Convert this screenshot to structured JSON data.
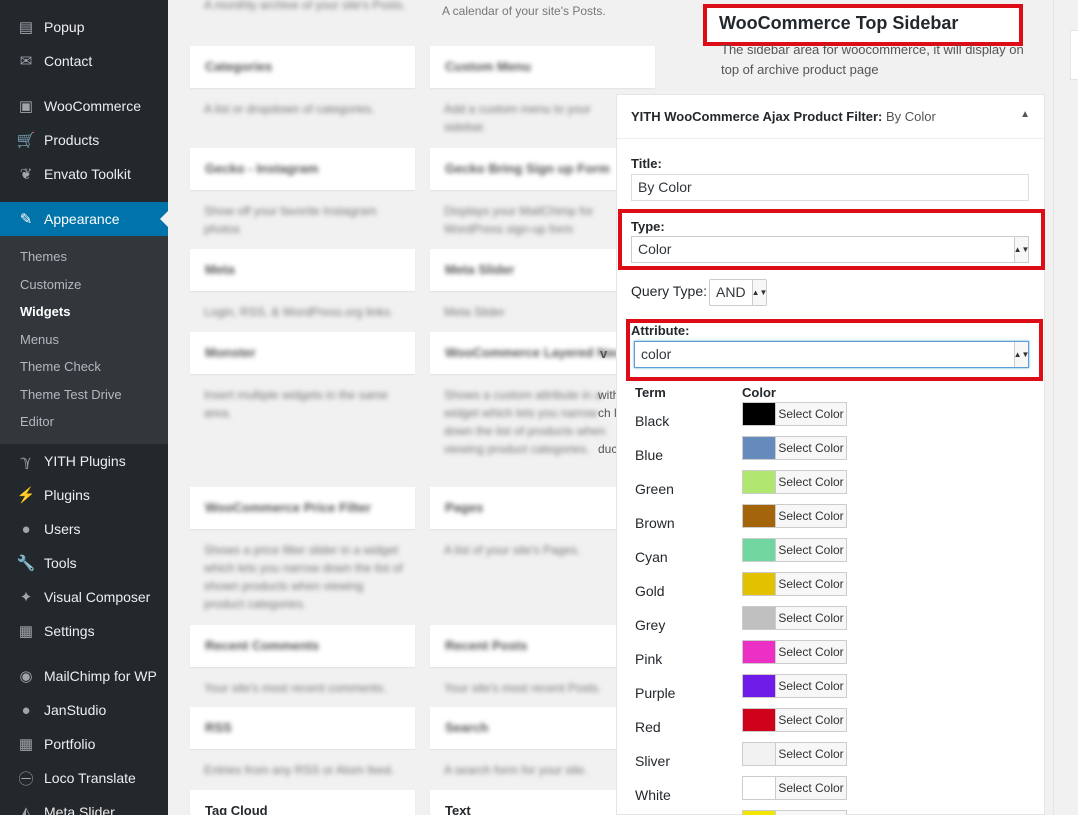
{
  "sidebar": {
    "items": [
      {
        "label": "Popup",
        "icon": "popup-icon",
        "glyph": "▤"
      },
      {
        "label": "Contact",
        "icon": "mail-icon",
        "glyph": "✉"
      },
      {
        "label": "WooCommerce",
        "icon": "woocommerce-icon",
        "glyph": "▣"
      },
      {
        "label": "Products",
        "icon": "cart-icon",
        "glyph": "🛒"
      },
      {
        "label": "Envato Toolkit",
        "icon": "leaf-icon",
        "glyph": "❦"
      },
      {
        "label": "Appearance",
        "icon": "brush-icon",
        "glyph": "✎"
      },
      {
        "label": "YITH Plugins",
        "icon": "yith-icon",
        "glyph": "ℽ"
      },
      {
        "label": "Plugins",
        "icon": "plug-icon",
        "glyph": "⚡"
      },
      {
        "label": "Users",
        "icon": "user-icon",
        "glyph": "●"
      },
      {
        "label": "Tools",
        "icon": "wrench-icon",
        "glyph": "🔧"
      },
      {
        "label": "Visual Composer",
        "icon": "visual-composer-icon",
        "glyph": "✦"
      },
      {
        "label": "Settings",
        "icon": "settings-icon",
        "glyph": "▦"
      },
      {
        "label": "MailChimp for WP",
        "icon": "mailchimp-icon",
        "glyph": "◉"
      },
      {
        "label": "JanStudio",
        "icon": "user-icon",
        "glyph": "●"
      },
      {
        "label": "Portfolio",
        "icon": "portfolio-icon",
        "glyph": "▦"
      },
      {
        "label": "Loco Translate",
        "icon": "translate-icon",
        "glyph": "㊀"
      },
      {
        "label": "Meta Slider",
        "icon": "slider-icon",
        "glyph": "◭"
      }
    ],
    "submenu": [
      "Themes",
      "Customize",
      "Widgets",
      "Menus",
      "Theme Check",
      "Theme Test Drive",
      "Editor"
    ]
  },
  "available": {
    "top_desc_left": "A monthly archive of your site's Posts.",
    "top_desc_right": "A calendar of your site's Posts.",
    "widgets": [
      {
        "title": "Categories",
        "desc": "A list or dropdown of categories."
      },
      {
        "title": "Custom Menu",
        "desc": "Add a custom menu to your sidebar."
      },
      {
        "title": "Gecko - Instagram",
        "desc": "Show off your favorite Instagram photos"
      },
      {
        "title": "Gecko Bring Sign up Form",
        "desc": "Displays your MailChimp for WordPress sign-up form"
      },
      {
        "title": "Meta",
        "desc": "Login, RSS, & WordPress.org links."
      },
      {
        "title": "Meta Slider",
        "desc": "Meta Slider"
      },
      {
        "title": "Monster",
        "desc": "Insert multiple widgets in the same area."
      },
      {
        "title": "WooCommerce Layered Nav",
        "desc": "Shows a custom attribute in a widget which lets you narrow down the list of products when viewing product categories."
      },
      {
        "title": "WooCommerce Price Filter",
        "desc": "Shows a price filter slider in a widget which lets you narrow down the list of shown products when viewing product categories."
      },
      {
        "title": "Pages",
        "desc": "A list of your site's Pages."
      },
      {
        "title": "Recent Comments",
        "desc": "Your site's most recent comments."
      },
      {
        "title": "Recent Posts",
        "desc": "Your site's most recent Posts."
      },
      {
        "title": "RSS",
        "desc": "Entries from any RSS or Atom feed."
      },
      {
        "title": "Search",
        "desc": "A search form for your site."
      },
      {
        "title": "Tag Cloud",
        "desc": ""
      },
      {
        "title": "Text",
        "desc": ""
      }
    ],
    "stub_v": "v",
    "stub_lines": [
      "with",
      "ch l",
      "",
      "duc"
    ]
  },
  "right_sidebar": {
    "title": "WooCommerce Top Sidebar",
    "description": "The sidebar area for woocommerce, it will display on top of archive product page"
  },
  "widget": {
    "header_main": "YITH WooCommerce Ajax Product Filter:",
    "header_sub": "By Color",
    "title_label": "Title:",
    "title_value": "By Color",
    "type_label": "Type:",
    "type_value": "Color",
    "query_type_label": "Query Type:",
    "query_type_value": "AND",
    "attribute_label": "Attribute:",
    "attribute_value": "color",
    "term_header": "Term",
    "color_header": "Color",
    "select_color_label": "Select Color",
    "terms": [
      {
        "name": "Black",
        "color": "#000000"
      },
      {
        "name": "Blue",
        "color": "#658bbd"
      },
      {
        "name": "Green",
        "color": "#b1e671"
      },
      {
        "name": "Brown",
        "color": "#a3640c"
      },
      {
        "name": "Cyan",
        "color": "#71d6a0"
      },
      {
        "name": "Gold",
        "color": "#e2c100"
      },
      {
        "name": "Grey",
        "color": "#c0c0c0"
      },
      {
        "name": "Pink",
        "color": "#ec2fc5"
      },
      {
        "name": "Purple",
        "color": "#6f1ce8"
      },
      {
        "name": "Red",
        "color": "#d0021b"
      },
      {
        "name": "Sliver",
        "color": "#f2f2f2"
      },
      {
        "name": "White",
        "color": "#ffffff"
      },
      {
        "name": "",
        "color": "#f2e600"
      }
    ]
  },
  "colors": {
    "sidebar_bg": "#23282d",
    "accent": "#0073aa",
    "highlight_red": "#dd0d17"
  }
}
